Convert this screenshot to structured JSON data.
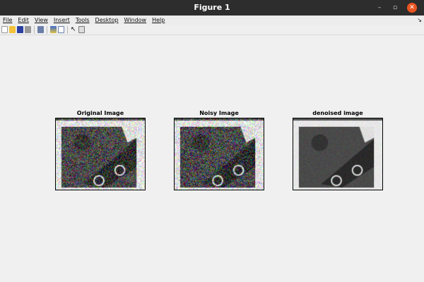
{
  "window": {
    "title": "Figure 1"
  },
  "menu": [
    "File",
    "Edit",
    "View",
    "Insert",
    "Tools",
    "Desktop",
    "Window",
    "Help"
  ],
  "toolbar": [
    "new-figure",
    "open-file",
    "save",
    "print",
    "print-preview",
    "link-plot",
    "insert-colorbar",
    "pointer",
    "insert-legend"
  ],
  "panels": [
    {
      "title": "Original Image",
      "noise": 0.55,
      "color": true
    },
    {
      "title": "Noisy Image",
      "noise": 0.6,
      "color": true
    },
    {
      "title": "denoised image",
      "noise": 0.08,
      "color": false
    }
  ],
  "colors": {
    "titlebar": "#2d2d2d",
    "close": "#e95420",
    "background": "#f0f0f0"
  }
}
